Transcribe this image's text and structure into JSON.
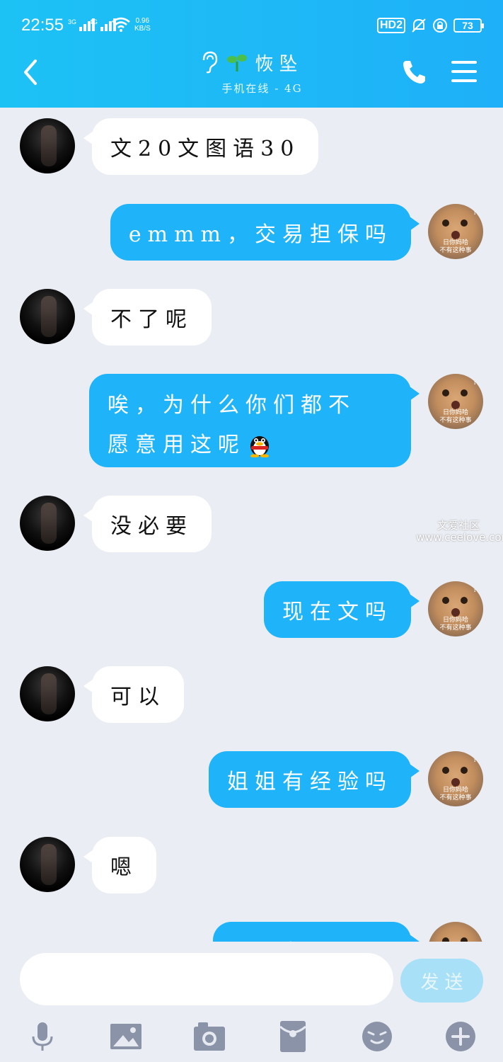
{
  "status_bar": {
    "time": "22:55",
    "net1": "3G",
    "net2": "4G",
    "speed_value": "0.96",
    "speed_unit": "KB/S",
    "hd": "HD2",
    "battery": "73"
  },
  "header": {
    "contact_name": "恢坠",
    "contact_status": "手机在线 - 4G"
  },
  "watermark": {
    "line1": "文爱社区",
    "line2": "www.ceelove.com"
  },
  "cat_avatar": {
    "caption_line1": "日你妈哈",
    "caption_line2": "不有这种事",
    "mark": "?"
  },
  "messages": [
    {
      "side": "left",
      "text": "文20文图语30"
    },
    {
      "side": "right",
      "text": "emmm，交易担保吗"
    },
    {
      "side": "left",
      "text": "不了呢"
    },
    {
      "side": "right",
      "line1": "唉，为什么你们都不",
      "line2": "愿意用这呢"
    },
    {
      "side": "left",
      "text": "没必要"
    },
    {
      "side": "right",
      "text": "现在文吗"
    },
    {
      "side": "left",
      "text": "可以"
    },
    {
      "side": "right",
      "text": "姐姐有经验吗"
    },
    {
      "side": "left",
      "text": "嗯"
    },
    {
      "side": "right",
      "text": "唉 一"
    }
  ],
  "input": {
    "placeholder": "",
    "value": "",
    "send_label": "发送"
  },
  "icons": [
    "back-icon",
    "ear-icon",
    "sprout-icon",
    "phone-icon",
    "menu-icon",
    "mic-icon",
    "image-icon",
    "camera-icon",
    "red-packet-icon",
    "emoji-icon",
    "plus-icon",
    "qq-penguin-icon"
  ]
}
